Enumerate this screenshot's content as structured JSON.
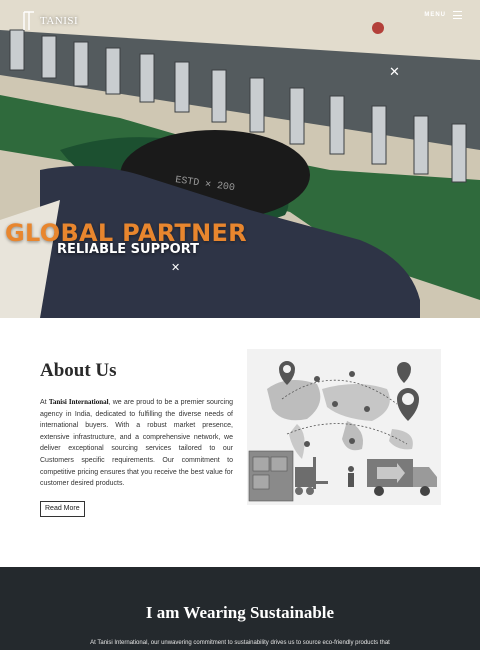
{
  "header": {
    "logo_text": "TANISI",
    "menu_label": "MENU"
  },
  "hero": {
    "headline": "GLOBAL PARTNER",
    "subheadline": "RELIABLE SUPPORT",
    "close_symbol": "✕",
    "hoop_stamp": "ESTD ✕ 200",
    "accent_color": "#e8862e"
  },
  "about": {
    "title": "About Us",
    "intro": "At ",
    "company": "Tanisi International",
    "body": ", we are proud to be a premier sourcing agency in India, dedicated to fulfilling the diverse needs of international buyers. With a robust market presence, extensive infrastructure, and a comprehensive network, we deliver exceptional sourcing services tailored to our Customers specific requirements. Our commitment to competitive pricing ensures that you receive the best value for customer desired products.",
    "read_more_label": "Read More"
  },
  "sustainable": {
    "title": "I am Wearing Sustainable",
    "text": "At Tanisi International, our unwavering commitment to sustainability drives us to source eco-friendly products that",
    "background_color": "#24292d"
  }
}
